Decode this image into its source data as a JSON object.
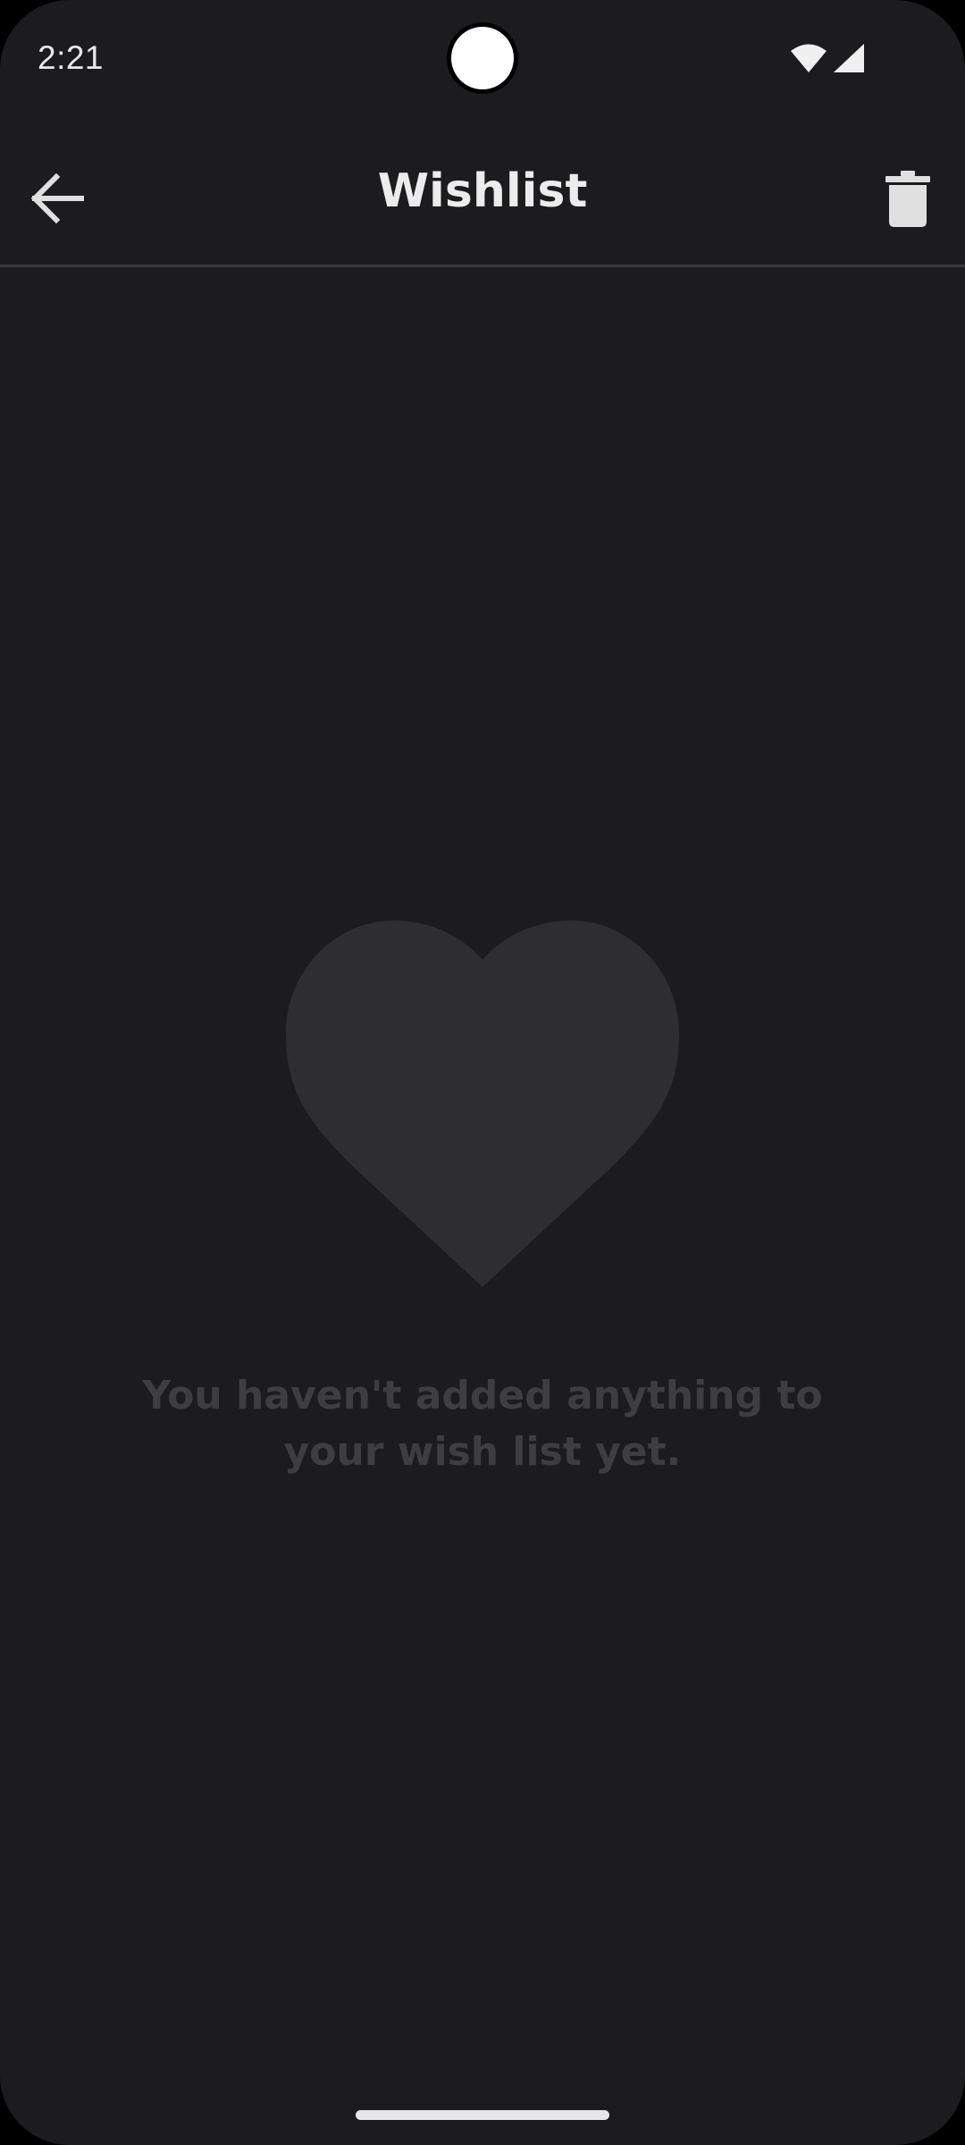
{
  "status_bar": {
    "time": "2:21",
    "icons": [
      "wifi-icon",
      "cell-signal-icon"
    ]
  },
  "app_bar": {
    "title": "Wishlist",
    "back_icon": "arrow-left-icon",
    "action_icon": "trash-icon"
  },
  "empty_state": {
    "icon": "heart-icon",
    "message": "You haven't added anything to your wish list yet."
  },
  "colors": {
    "background": "#1c1c1e",
    "title_text": "#ececec",
    "icon": "#e0e0e0",
    "heart": "#2e2e31",
    "empty_text": "#3e3e41",
    "divider": "#38383a"
  }
}
